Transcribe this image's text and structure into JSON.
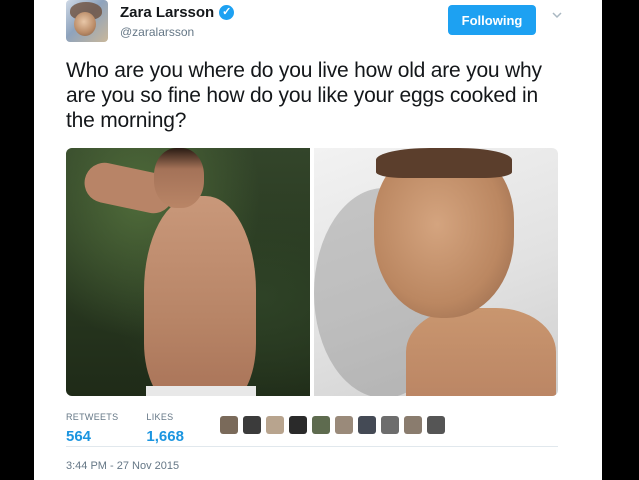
{
  "user": {
    "name": "Zara Larsson",
    "handle": "@zaralarsson",
    "verified_icon": "verified-check-icon"
  },
  "follow_button": {
    "label": "Following"
  },
  "menu_icon": "chevron-down-icon",
  "tweet": {
    "text": "Who are you where do you live how old are you why are you so fine how do you like your eggs cooked in the morning?"
  },
  "stats": {
    "retweets_label": "RETWEETS",
    "retweets_value": "564",
    "likes_label": "LIKES",
    "likes_value": "1,668"
  },
  "likers": [
    {
      "name": "liker-avatar-1",
      "color": "#7a6a5a"
    },
    {
      "name": "liker-avatar-2",
      "color": "#3b3b3b"
    },
    {
      "name": "liker-avatar-3",
      "color": "#b8a48e"
    },
    {
      "name": "liker-avatar-4",
      "color": "#2a2a2a"
    },
    {
      "name": "liker-avatar-5",
      "color": "#5e6b4f"
    },
    {
      "name": "liker-avatar-6",
      "color": "#9a8a7a"
    },
    {
      "name": "liker-avatar-7",
      "color": "#444a55"
    },
    {
      "name": "liker-avatar-8",
      "color": "#6d6d6d"
    },
    {
      "name": "liker-avatar-9",
      "color": "#8a7c6e"
    },
    {
      "name": "liker-avatar-10",
      "color": "#555555"
    }
  ],
  "timestamp": "3:44 PM - 27 Nov 2015",
  "colors": {
    "accent": "#1da1f2",
    "link": "#1b95e0",
    "text": "#14171a",
    "muted": "#657786"
  }
}
